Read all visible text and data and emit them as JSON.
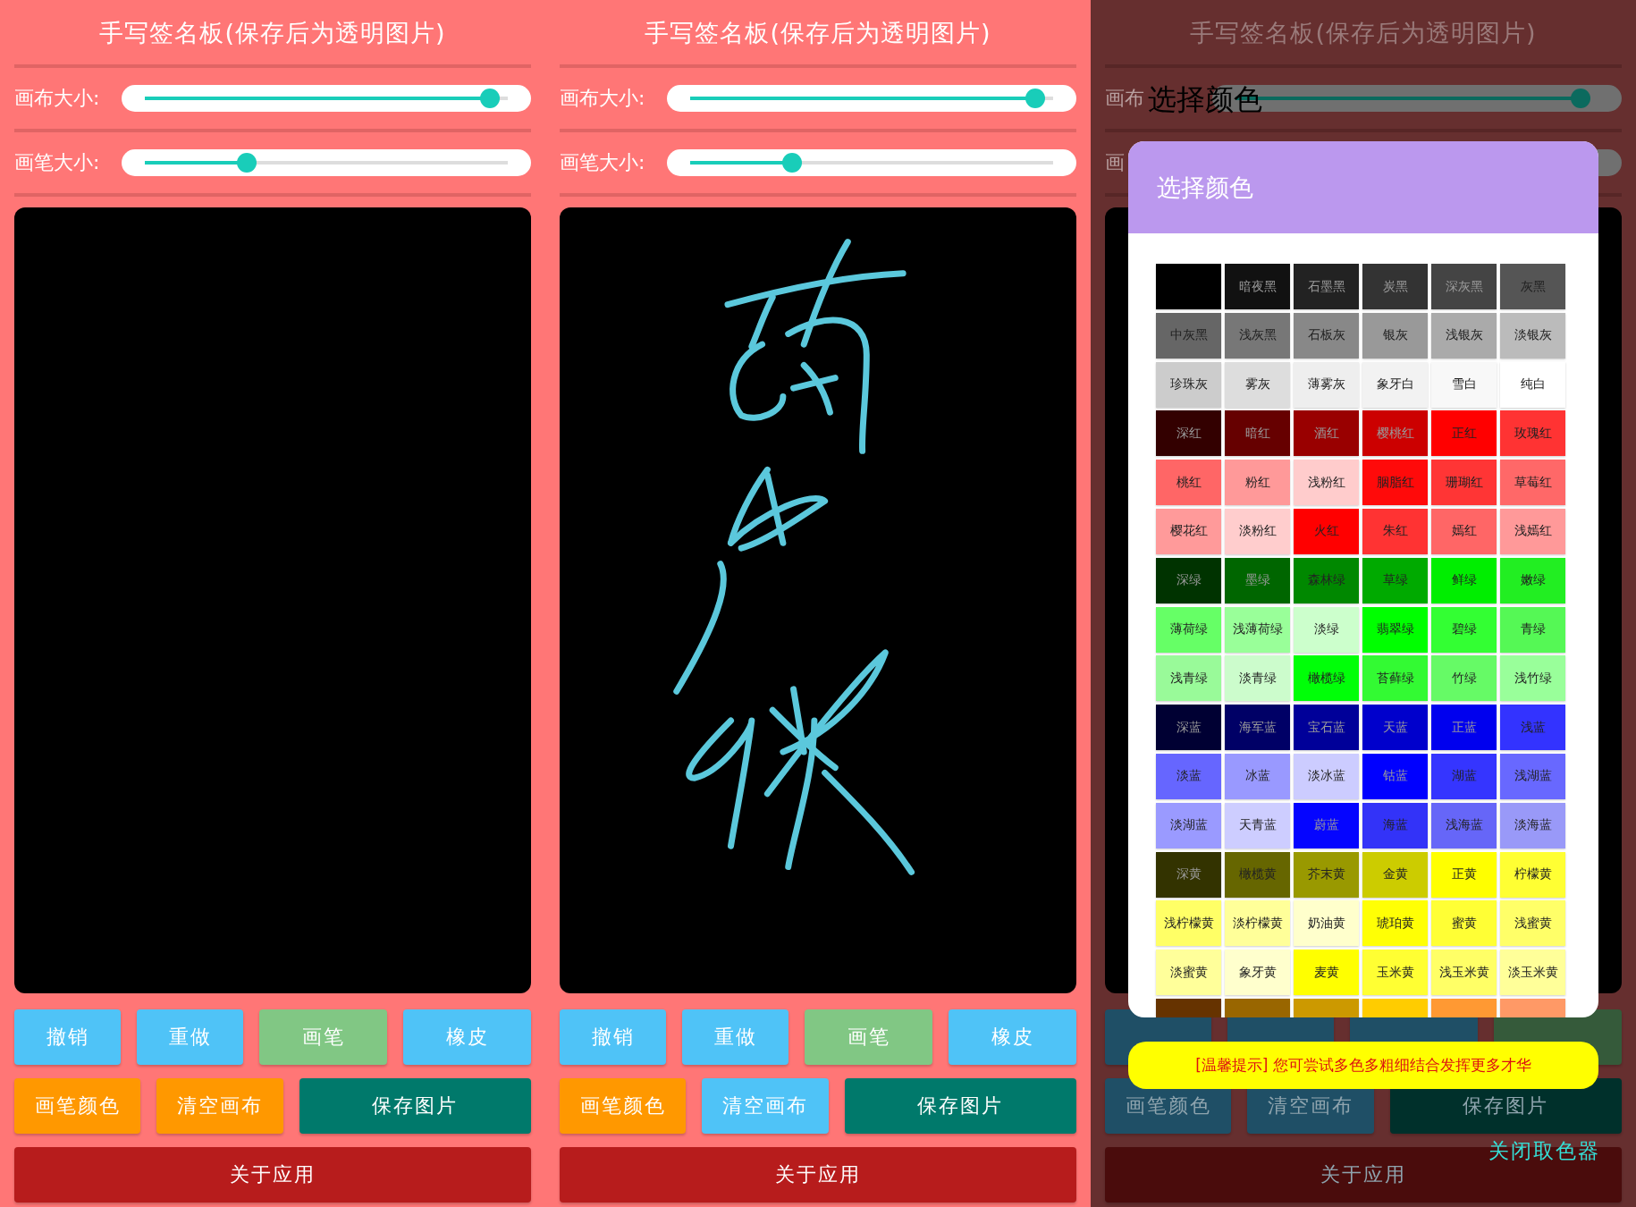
{
  "screens": [
    {
      "title": "手写签名板(保存后为透明图片)",
      "dimmed": false,
      "sliders": [
        {
          "label": "画布大小:",
          "level": 0.95
        },
        {
          "label": "画笔大小:",
          "level": 0.28
        }
      ],
      "canvas": {
        "signature": false
      },
      "button_rows": [
        [
          {
            "label": "撤销",
            "color": "#4fc3f7"
          },
          {
            "label": "重做",
            "color": "#4fc3f7"
          },
          {
            "label": "画笔",
            "color": "#81c784"
          },
          {
            "label": "橡皮",
            "color": "#4fc3f7"
          }
        ],
        [
          {
            "label": "画笔颜色",
            "color": "#ff9800"
          },
          {
            "label": "清空画布",
            "color": "#ff9800"
          },
          {
            "label": "保存图片",
            "color": "#00796b"
          }
        ],
        [
          {
            "label": "关于应用",
            "color": "#b71c1c"
          }
        ]
      ]
    },
    {
      "title": "手写签名板(保存后为透明图片)",
      "dimmed": false,
      "sliders": [
        {
          "label": "画布大小:",
          "level": 0.95
        },
        {
          "label": "画笔大小:",
          "level": 0.28
        }
      ],
      "canvas": {
        "signature": true
      },
      "button_rows": [
        [
          {
            "label": "撤销",
            "color": "#4fc3f7"
          },
          {
            "label": "重做",
            "color": "#4fc3f7"
          },
          {
            "label": "画笔",
            "color": "#81c784"
          },
          {
            "label": "橡皮",
            "color": "#4fc3f7"
          }
        ],
        [
          {
            "label": "画笔颜色",
            "color": "#ff9800"
          },
          {
            "label": "清空画布",
            "color": "#4fc3f7"
          },
          {
            "label": "保存图片",
            "color": "#00796b"
          }
        ],
        [
          {
            "label": "关于应用",
            "color": "#b71c1c"
          }
        ]
      ]
    },
    {
      "title": "手写签名板(保存后为透明图片)",
      "dimmed": true,
      "sliders": [
        {
          "label": "画布",
          "level": 0.95
        },
        {
          "label": "画",
          "level": 0.28
        }
      ],
      "button_rows": [
        [
          {
            "color": "#1f4f66"
          },
          {
            "color": "#1f4f66"
          },
          {
            "color": "#1f4f66"
          },
          {
            "color": "#355a3a"
          }
        ],
        [
          {
            "label": "画笔颜色",
            "color": "#1f4f66"
          },
          {
            "label": "清空画布",
            "color": "#1f4f66"
          },
          {
            "label": "保存图片",
            "color": "#00302b"
          }
        ],
        [
          {
            "label": "关于应用",
            "color": "#4a0c0c"
          }
        ]
      ],
      "color_picker": {
        "overlay_title": "选择颜色",
        "title": "选择颜色",
        "tip": "[温馨提示] 您可尝试多色多粗细结合发挥更多才华",
        "close": "关闭取色器",
        "swatches": [
          {
            "color": "#000000"
          },
          {
            "label": "暗夜黑",
            "color": "#111111"
          },
          {
            "label": "石墨黑",
            "color": "#222222"
          },
          {
            "label": "炭黑",
            "color": "#333333"
          },
          {
            "label": "深灰黑",
            "color": "#444444"
          },
          {
            "label": "灰黑",
            "color": "#555555"
          },
          {
            "label": "中灰黑",
            "color": "#666666"
          },
          {
            "label": "浅灰黑",
            "color": "#777777"
          },
          {
            "label": "石板灰",
            "color": "#888888"
          },
          {
            "label": "银灰",
            "color": "#999999"
          },
          {
            "label": "浅银灰",
            "color": "#aaaaaa"
          },
          {
            "label": "淡银灰",
            "color": "#bbbbbb"
          },
          {
            "label": "珍珠灰",
            "color": "#cccccc"
          },
          {
            "label": "雾灰",
            "color": "#dddddd"
          },
          {
            "label": "薄雾灰",
            "color": "#eeeeee"
          },
          {
            "label": "象牙白",
            "color": "#f2f2f2"
          },
          {
            "label": "雪白",
            "color": "#f8f8f8"
          },
          {
            "label": "纯白",
            "color": "#ffffff"
          },
          {
            "label": "深红",
            "color": "#330000"
          },
          {
            "label": "暗红",
            "color": "#660000"
          },
          {
            "label": "酒红",
            "color": "#990000"
          },
          {
            "label": "樱桃红",
            "color": "#cc0000"
          },
          {
            "label": "正红",
            "color": "#ff0000"
          },
          {
            "label": "玫瑰红",
            "color": "#ff3333"
          },
          {
            "label": "桃红",
            "color": "#ff6666"
          },
          {
            "label": "粉红",
            "color": "#ff9999"
          },
          {
            "label": "浅粉红",
            "color": "#ffcccc"
          },
          {
            "label": "胭脂红",
            "color": "#ff0a0a"
          },
          {
            "label": "珊瑚红",
            "color": "#ff3535"
          },
          {
            "label": "草莓红",
            "color": "#ff6868"
          },
          {
            "label": "樱花红",
            "color": "#ff9a9a"
          },
          {
            "label": "淡粉红",
            "color": "#ffcdcd"
          },
          {
            "label": "火红",
            "color": "#ff0000"
          },
          {
            "label": "朱红",
            "color": "#ff3333"
          },
          {
            "label": "嫣红",
            "color": "#ff6666"
          },
          {
            "label": "浅嫣红",
            "color": "#ff9999"
          },
          {
            "label": "深绿",
            "color": "#003300"
          },
          {
            "label": "墨绿",
            "color": "#006600"
          },
          {
            "label": "森林绿",
            "color": "#008800"
          },
          {
            "label": "草绿",
            "color": "#00aa00"
          },
          {
            "label": "鲜绿",
            "color": "#00ee00"
          },
          {
            "label": "嫩绿",
            "color": "#22ee22"
          },
          {
            "label": "薄荷绿",
            "color": "#66ff66"
          },
          {
            "label": "浅薄荷绿",
            "color": "#99ff99"
          },
          {
            "label": "淡绿",
            "color": "#ccffcc"
          },
          {
            "label": "翡翠绿",
            "color": "#00ff00"
          },
          {
            "label": "碧绿",
            "color": "#33ff33"
          },
          {
            "label": "青绿",
            "color": "#55f855"
          },
          {
            "label": "浅青绿",
            "color": "#99fa99"
          },
          {
            "label": "淡青绿",
            "color": "#ccfccc"
          },
          {
            "label": "橄榄绿",
            "color": "#00ff08"
          },
          {
            "label": "苔藓绿",
            "color": "#33fa33"
          },
          {
            "label": "竹绿",
            "color": "#66fa66"
          },
          {
            "label": "浅竹绿",
            "color": "#99ff9a"
          },
          {
            "label": "深蓝",
            "color": "#000033"
          },
          {
            "label": "海军蓝",
            "color": "#000066"
          },
          {
            "label": "宝石蓝",
            "color": "#000099"
          },
          {
            "label": "天蓝",
            "color": "#0000cc"
          },
          {
            "label": "正蓝",
            "color": "#0000ee"
          },
          {
            "label": "浅蓝",
            "color": "#3333ff"
          },
          {
            "label": "淡蓝",
            "color": "#6666ff"
          },
          {
            "label": "冰蓝",
            "color": "#9999ff"
          },
          {
            "label": "淡冰蓝",
            "color": "#ccccff"
          },
          {
            "label": "钴蓝",
            "color": "#0000ff"
          },
          {
            "label": "湖蓝",
            "color": "#3535ff"
          },
          {
            "label": "浅湖蓝",
            "color": "#6868ff"
          },
          {
            "label": "淡湖蓝",
            "color": "#9a9aff"
          },
          {
            "label": "天青蓝",
            "color": "#cdcdff"
          },
          {
            "label": "蔚蓝",
            "color": "#0505ff"
          },
          {
            "label": "海蓝",
            "color": "#3333f8"
          },
          {
            "label": "浅海蓝",
            "color": "#6666f8"
          },
          {
            "label": "淡海蓝",
            "color": "#9999f8"
          },
          {
            "label": "深黄",
            "color": "#333300"
          },
          {
            "label": "橄榄黄",
            "color": "#666600"
          },
          {
            "label": "芥末黄",
            "color": "#999900"
          },
          {
            "label": "金黄",
            "color": "#cccc00"
          },
          {
            "label": "正黄",
            "color": "#ffff00"
          },
          {
            "label": "柠檬黄",
            "color": "#ffff33"
          },
          {
            "label": "浅柠檬黄",
            "color": "#ffff66"
          },
          {
            "label": "淡柠檬黄",
            "color": "#ffff99"
          },
          {
            "label": "奶油黄",
            "color": "#ffffcc"
          },
          {
            "label": "琥珀黄",
            "color": "#ffff05"
          },
          {
            "label": "蜜黄",
            "color": "#ffff35"
          },
          {
            "label": "浅蜜黄",
            "color": "#ffff68"
          },
          {
            "label": "淡蜜黄",
            "color": "#ffff9a"
          },
          {
            "label": "象牙黄",
            "color": "#ffffcd"
          },
          {
            "label": "麦黄",
            "color": "#ffff00"
          },
          {
            "label": "玉米黄",
            "color": "#ffff33"
          },
          {
            "label": "浅玉米黄",
            "color": "#ffff66"
          },
          {
            "label": "淡玉米黄",
            "color": "#ffff99"
          },
          {
            "color": "#663300"
          },
          {
            "color": "#996600"
          },
          {
            "color": "#cc9900"
          },
          {
            "color": "#ffcc00"
          },
          {
            "color": "#ff9933"
          },
          {
            "color": "#ff9966"
          }
        ]
      }
    }
  ]
}
